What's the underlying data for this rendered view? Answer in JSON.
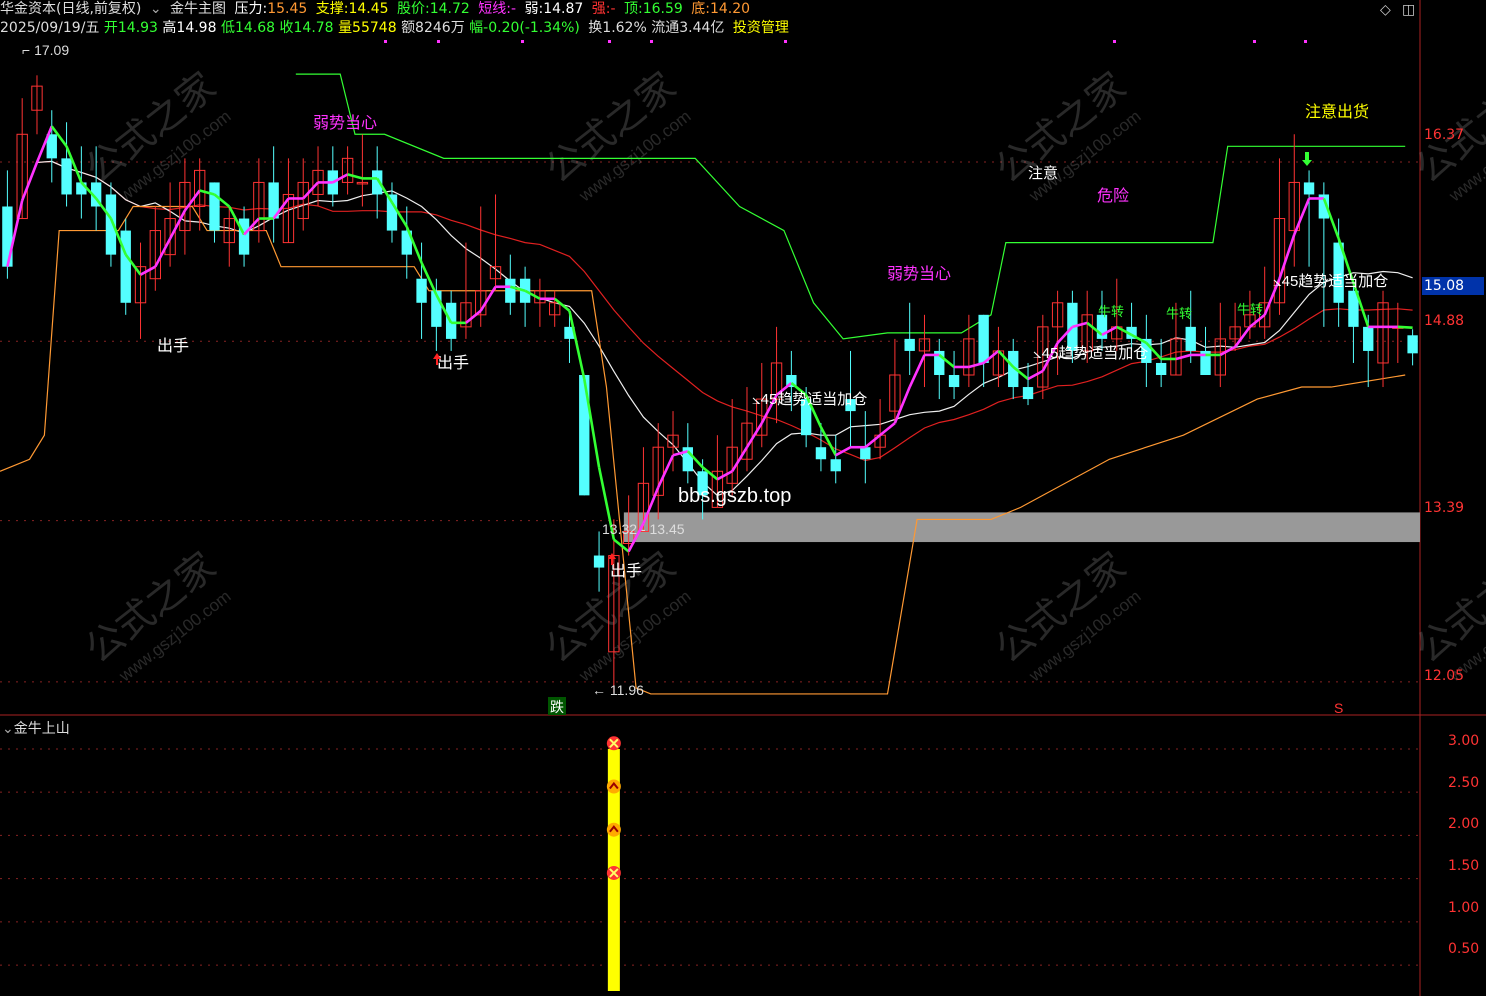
{
  "header1": {
    "stock": "华金资本(日线,前复权)",
    "indicator_name": "金牛主图",
    "pressure_label": "压力:",
    "pressure_value": "15.45",
    "support_label": "支撑:",
    "support_value": "14.45",
    "price_label": "股价:",
    "price_value": "14.72",
    "short_label": "短线:",
    "short_value": "-",
    "weak_label": "弱:",
    "weak_value": "14.87",
    "strong_label": "强:",
    "strong_value": "-",
    "top_label": "顶:",
    "top_value": "16.59",
    "bottom_label": "底:",
    "bottom_value": "14.20"
  },
  "header2": {
    "date": "2025/09/19/五",
    "open": "开14.93",
    "high": "高14.98",
    "low": "低14.68",
    "close": "收14.78",
    "volume": "量55748",
    "amount": "额8246万",
    "change": "幅-0.20(-1.34%)",
    "turnover": "换1.62%",
    "float": "流通3.44亿",
    "menu": "投资管理"
  },
  "price_axis": [
    "16.37",
    "15.08",
    "14.88",
    "13.39",
    "12.05"
  ],
  "current_price_box": "15.08",
  "sub_panel": {
    "title": "金牛上山",
    "axis": [
      "3.00",
      "2.50",
      "2.00",
      "1.50",
      "1.00",
      "0.50"
    ]
  },
  "labels": {
    "high_mark": "17.09",
    "low_mark": "11.96",
    "range_text": "13.32 - 13.45",
    "watermark_url": "bbs.gszb.top",
    "chushou": "出手",
    "ruoshi": "弱势当心",
    "zhuyi": "注意",
    "weixian": "危险",
    "zhuyichuhuo": "注意出货",
    "qushi": "45趋势适当加仓",
    "niuzhuan": "牛转",
    "die": "跌",
    "s_mark": "S",
    "wm_cn": "公式之家",
    "wm_url": "www.gszj100.com"
  },
  "colors": {
    "up": "#ff3333",
    "down": "#54ffff",
    "green_line": "#33ff33",
    "magenta": "#ff33ff",
    "orange": "#ff9933",
    "yellow": "#ffff00"
  },
  "chart_data": {
    "type": "candlestick",
    "candles": [
      {
        "o": 16.0,
        "c": 15.5,
        "h": 16.3,
        "l": 15.4
      },
      {
        "o": 15.9,
        "c": 16.6,
        "h": 16.9,
        "l": 15.9
      },
      {
        "o": 16.8,
        "c": 17.0,
        "h": 17.09,
        "l": 16.6
      },
      {
        "o": 16.6,
        "c": 16.4,
        "h": 16.8,
        "l": 16.2
      },
      {
        "o": 16.4,
        "c": 16.1,
        "h": 16.7,
        "l": 16.0
      },
      {
        "o": 16.2,
        "c": 16.1,
        "h": 16.5,
        "l": 15.9
      },
      {
        "o": 16.2,
        "c": 16.0,
        "h": 16.5,
        "l": 15.8
      },
      {
        "o": 16.1,
        "c": 15.6,
        "h": 16.2,
        "l": 15.5
      },
      {
        "o": 15.8,
        "c": 15.2,
        "h": 15.9,
        "l": 15.1
      },
      {
        "o": 15.2,
        "c": 15.5,
        "h": 15.7,
        "l": 14.9
      },
      {
        "o": 15.4,
        "c": 15.8,
        "h": 16.0,
        "l": 15.3
      },
      {
        "o": 15.6,
        "c": 15.9,
        "h": 16.2,
        "l": 15.5
      },
      {
        "o": 15.8,
        "c": 16.2,
        "h": 16.4,
        "l": 15.6
      },
      {
        "o": 16.0,
        "c": 16.3,
        "h": 16.4,
        "l": 15.8
      },
      {
        "o": 16.2,
        "c": 15.8,
        "h": 16.2,
        "l": 15.7
      },
      {
        "o": 15.7,
        "c": 15.9,
        "h": 16.0,
        "l": 15.5
      },
      {
        "o": 15.9,
        "c": 15.6,
        "h": 16.0,
        "l": 15.5
      },
      {
        "o": 15.8,
        "c": 16.2,
        "h": 16.4,
        "l": 15.7
      },
      {
        "o": 16.2,
        "c": 15.9,
        "h": 16.5,
        "l": 15.7
      },
      {
        "o": 15.7,
        "c": 16.1,
        "h": 16.4,
        "l": 15.7
      },
      {
        "o": 15.9,
        "c": 16.2,
        "h": 16.4,
        "l": 15.8
      },
      {
        "o": 16.1,
        "c": 16.3,
        "h": 16.5,
        "l": 16.0
      },
      {
        "o": 16.3,
        "c": 16.1,
        "h": 16.5,
        "l": 16.0
      },
      {
        "o": 16.2,
        "c": 16.4,
        "h": 16.5,
        "l": 16.1
      },
      {
        "o": 16.2,
        "c": 16.2,
        "h": 16.6,
        "l": 16.0
      },
      {
        "o": 16.3,
        "c": 16.1,
        "h": 16.5,
        "l": 15.9
      },
      {
        "o": 16.1,
        "c": 15.8,
        "h": 16.2,
        "l": 15.7
      },
      {
        "o": 15.8,
        "c": 15.6,
        "h": 16.0,
        "l": 15.4
      },
      {
        "o": 15.4,
        "c": 15.2,
        "h": 15.7,
        "l": 14.9
      },
      {
        "o": 15.3,
        "c": 15.0,
        "h": 15.4,
        "l": 14.8
      },
      {
        "o": 15.2,
        "c": 14.9,
        "h": 15.3,
        "l": 14.8
      },
      {
        "o": 15.0,
        "c": 15.2,
        "h": 15.7,
        "l": 14.9
      },
      {
        "o": 15.1,
        "c": 15.3,
        "h": 16.0,
        "l": 15.0
      },
      {
        "o": 15.4,
        "c": 15.5,
        "h": 16.1,
        "l": 15.3
      },
      {
        "o": 15.4,
        "c": 15.2,
        "h": 15.6,
        "l": 15.1
      },
      {
        "o": 15.4,
        "c": 15.2,
        "h": 15.5,
        "l": 15.0
      },
      {
        "o": 15.2,
        "c": 15.3,
        "h": 15.4,
        "l": 15.0
      },
      {
        "o": 15.1,
        "c": 15.2,
        "h": 15.3,
        "l": 15.0
      },
      {
        "o": 15.0,
        "c": 14.9,
        "h": 15.1,
        "l": 14.7
      },
      {
        "o": 14.6,
        "c": 13.6,
        "h": 14.6,
        "l": 13.6
      },
      {
        "o": 13.1,
        "c": 13.0,
        "h": 13.3,
        "l": 12.8
      },
      {
        "o": 12.3,
        "c": 13.1,
        "h": 13.4,
        "l": 11.96
      },
      {
        "o": 13.2,
        "c": 13.3,
        "h": 13.6,
        "l": 13.1
      },
      {
        "o": 13.3,
        "c": 13.7,
        "h": 14.0,
        "l": 13.3
      },
      {
        "o": 13.6,
        "c": 14.0,
        "h": 14.2,
        "l": 13.4
      },
      {
        "o": 14.0,
        "c": 14.1,
        "h": 14.3,
        "l": 13.8
      },
      {
        "o": 14.0,
        "c": 13.8,
        "h": 14.2,
        "l": 13.7
      },
      {
        "o": 13.8,
        "c": 13.6,
        "h": 13.9,
        "l": 13.4
      },
      {
        "o": 13.5,
        "c": 13.8,
        "h": 14.1,
        "l": 13.5
      },
      {
        "o": 13.7,
        "c": 14.0,
        "h": 14.4,
        "l": 13.6
      },
      {
        "o": 13.9,
        "c": 14.2,
        "h": 14.5,
        "l": 13.8
      },
      {
        "o": 14.1,
        "c": 14.4,
        "h": 14.7,
        "l": 14.0
      },
      {
        "o": 14.4,
        "c": 14.7,
        "h": 15.0,
        "l": 14.2
      },
      {
        "o": 14.6,
        "c": 14.5,
        "h": 14.8,
        "l": 14.3
      },
      {
        "o": 14.4,
        "c": 14.1,
        "h": 14.5,
        "l": 14.0
      },
      {
        "o": 14.0,
        "c": 13.9,
        "h": 14.2,
        "l": 13.8
      },
      {
        "o": 13.9,
        "c": 13.8,
        "h": 14.1,
        "l": 13.7
      },
      {
        "o": 14.4,
        "c": 14.3,
        "h": 14.8,
        "l": 14.0
      },
      {
        "o": 14.0,
        "c": 13.9,
        "h": 14.3,
        "l": 13.7
      },
      {
        "o": 14.0,
        "c": 14.1,
        "h": 14.4,
        "l": 13.9
      },
      {
        "o": 14.3,
        "c": 14.6,
        "h": 14.9,
        "l": 14.2
      },
      {
        "o": 14.9,
        "c": 14.8,
        "h": 15.2,
        "l": 14.6
      },
      {
        "o": 14.8,
        "c": 14.9,
        "h": 15.1,
        "l": 14.5
      },
      {
        "o": 14.8,
        "c": 14.6,
        "h": 14.9,
        "l": 14.4
      },
      {
        "o": 14.6,
        "c": 14.5,
        "h": 14.8,
        "l": 14.4
      },
      {
        "o": 14.6,
        "c": 14.9,
        "h": 15.1,
        "l": 14.5
      },
      {
        "o": 15.1,
        "c": 14.7,
        "h": 15.1,
        "l": 14.5
      },
      {
        "o": 14.6,
        "c": 14.8,
        "h": 15.0,
        "l": 14.5
      },
      {
        "o": 14.8,
        "c": 14.5,
        "h": 14.9,
        "l": 14.4
      },
      {
        "o": 14.5,
        "c": 14.4,
        "h": 14.7,
        "l": 14.35
      },
      {
        "o": 14.5,
        "c": 15.0,
        "h": 15.1,
        "l": 14.4
      },
      {
        "o": 15.0,
        "c": 15.2,
        "h": 15.3,
        "l": 14.6
      },
      {
        "o": 15.2,
        "c": 14.8,
        "h": 15.3,
        "l": 14.7
      },
      {
        "o": 14.8,
        "c": 15.1,
        "h": 15.3,
        "l": 14.7
      },
      {
        "o": 15.1,
        "c": 14.9,
        "h": 15.3,
        "l": 14.8
      },
      {
        "o": 14.9,
        "c": 15.0,
        "h": 15.4,
        "l": 14.8
      },
      {
        "o": 15.0,
        "c": 14.9,
        "h": 15.2,
        "l": 14.8
      },
      {
        "o": 14.9,
        "c": 14.7,
        "h": 15.1,
        "l": 14.5
      },
      {
        "o": 14.7,
        "c": 14.6,
        "h": 14.9,
        "l": 14.5
      },
      {
        "o": 14.6,
        "c": 14.9,
        "h": 15.2,
        "l": 14.6
      },
      {
        "o": 15.0,
        "c": 14.8,
        "h": 15.3,
        "l": 14.7
      },
      {
        "o": 14.8,
        "c": 14.6,
        "h": 15.0,
        "l": 14.6
      },
      {
        "o": 14.6,
        "c": 14.9,
        "h": 15.2,
        "l": 14.5
      },
      {
        "o": 14.9,
        "c": 15.0,
        "h": 15.2,
        "l": 14.8
      },
      {
        "o": 15.0,
        "c": 15.1,
        "h": 15.3,
        "l": 14.9
      },
      {
        "o": 15.0,
        "c": 15.2,
        "h": 15.5,
        "l": 14.9
      },
      {
        "o": 15.2,
        "c": 15.9,
        "h": 16.4,
        "l": 15.1
      },
      {
        "o": 15.8,
        "c": 16.2,
        "h": 16.6,
        "l": 15.5
      },
      {
        "o": 16.2,
        "c": 16.1,
        "h": 16.3,
        "l": 15.5
      },
      {
        "o": 16.1,
        "c": 15.9,
        "h": 16.2,
        "l": 15.0
      },
      {
        "o": 15.7,
        "c": 15.2,
        "h": 15.9,
        "l": 15.0
      },
      {
        "o": 15.3,
        "c": 15.0,
        "h": 15.4,
        "l": 14.7
      },
      {
        "o": 15.0,
        "c": 14.8,
        "h": 15.1,
        "l": 14.5
      },
      {
        "o": 14.7,
        "c": 15.2,
        "h": 15.3,
        "l": 14.5
      },
      {
        "o": 15.0,
        "c": 15.0,
        "h": 15.2,
        "l": 14.7
      },
      {
        "o": 14.93,
        "c": 14.78,
        "h": 14.98,
        "l": 14.68
      }
    ],
    "y_range": [
      11.8,
      17.4
    ],
    "sub_histogram": {
      "index": 41,
      "value": 3.0
    }
  }
}
